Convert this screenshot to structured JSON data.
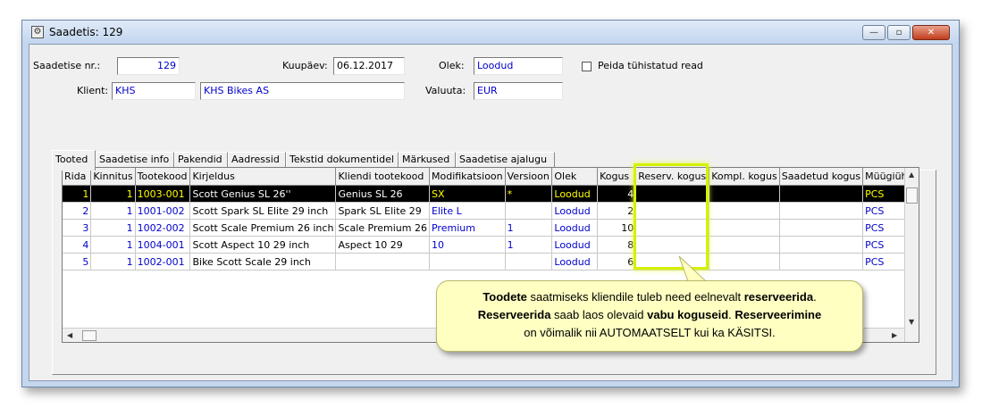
{
  "window": {
    "title": "Saadetis: 129",
    "buttons": {
      "minimize": "—",
      "maximize": "▫",
      "close": "✕"
    }
  },
  "form": {
    "saadetise_nr_label": "Saadetise nr.:",
    "saadetise_nr": "129",
    "kuupaev_label": "Kuupäev:",
    "kuupaev": "06.12.2017",
    "olek_label": "Olek:",
    "olek": "Loodud",
    "peida_label": "Peida tühistatud read",
    "klient_label": "Klient:",
    "klient_code": "KHS",
    "klient_name": "KHS Bikes AS",
    "valuuta_label": "Valuuta:",
    "valuuta": "EUR"
  },
  "tabs": [
    "Tooted",
    "Saadetise info",
    "Pakendid",
    "Aadressid",
    "Tekstid dokumentidel",
    "Märkused",
    "Saadetise ajalugu"
  ],
  "grid": {
    "columns": [
      "Rida",
      "Kinnitus",
      "Tootekood",
      "Kirjeldus",
      "Kliendi tootekood",
      "Modifikatsioon",
      "Versioon",
      "Olek",
      "Kogus",
      "Reserv. kogus",
      "Kompl. kogus",
      "Saadetud kogus",
      "Müügiühik"
    ],
    "rows": [
      [
        "1",
        "1",
        "1003-001",
        "Scott Genius SL 26''",
        "Genius SL 26",
        "SX",
        "*",
        "Loodud",
        "4",
        "",
        "",
        "",
        "PCS"
      ],
      [
        "2",
        "1",
        "1001-002",
        "Scott Spark SL Elite 29 inch",
        "Spark SL Elite 29",
        "Elite L",
        "",
        "Loodud",
        "2",
        "",
        "",
        "",
        "PCS"
      ],
      [
        "3",
        "1",
        "1002-002",
        "Scott Scale Premium 26 inch",
        "Scale Premium 26",
        "Premium",
        "1",
        "Loodud",
        "10",
        "",
        "",
        "",
        "PCS"
      ],
      [
        "4",
        "1",
        "1004-001",
        "Scott Aspect 10 29 inch",
        "Aspect 10 29",
        "10",
        "1",
        "Loodud",
        "8",
        "",
        "",
        "",
        "PCS"
      ],
      [
        "5",
        "1",
        "1002-001",
        "Bike Scott Scale 29 inch",
        "",
        "",
        "",
        "Loodud",
        "6",
        "",
        "",
        "",
        "PCS"
      ]
    ]
  },
  "callout": {
    "line1_b1": "Toodete",
    "line1_t1": " saatmiseks kliendile tuleb need eelnevalt ",
    "line1_b2": "reserveerida",
    "line1_t2": ".",
    "line2_b1": "Reserveerida",
    "line2_t1": " saab laos olevaid ",
    "line2_b2": "vabu koguseid",
    "line2_t2": ". ",
    "line2_b3": "Reserveerimine",
    "line3": "on võimalik nii AUTOMAATSELT kui ka KÄSITSI."
  },
  "colors": {
    "highlight": "#d6f000",
    "callout_bg": "#ffffc2",
    "link_blue": "#0000cc"
  }
}
